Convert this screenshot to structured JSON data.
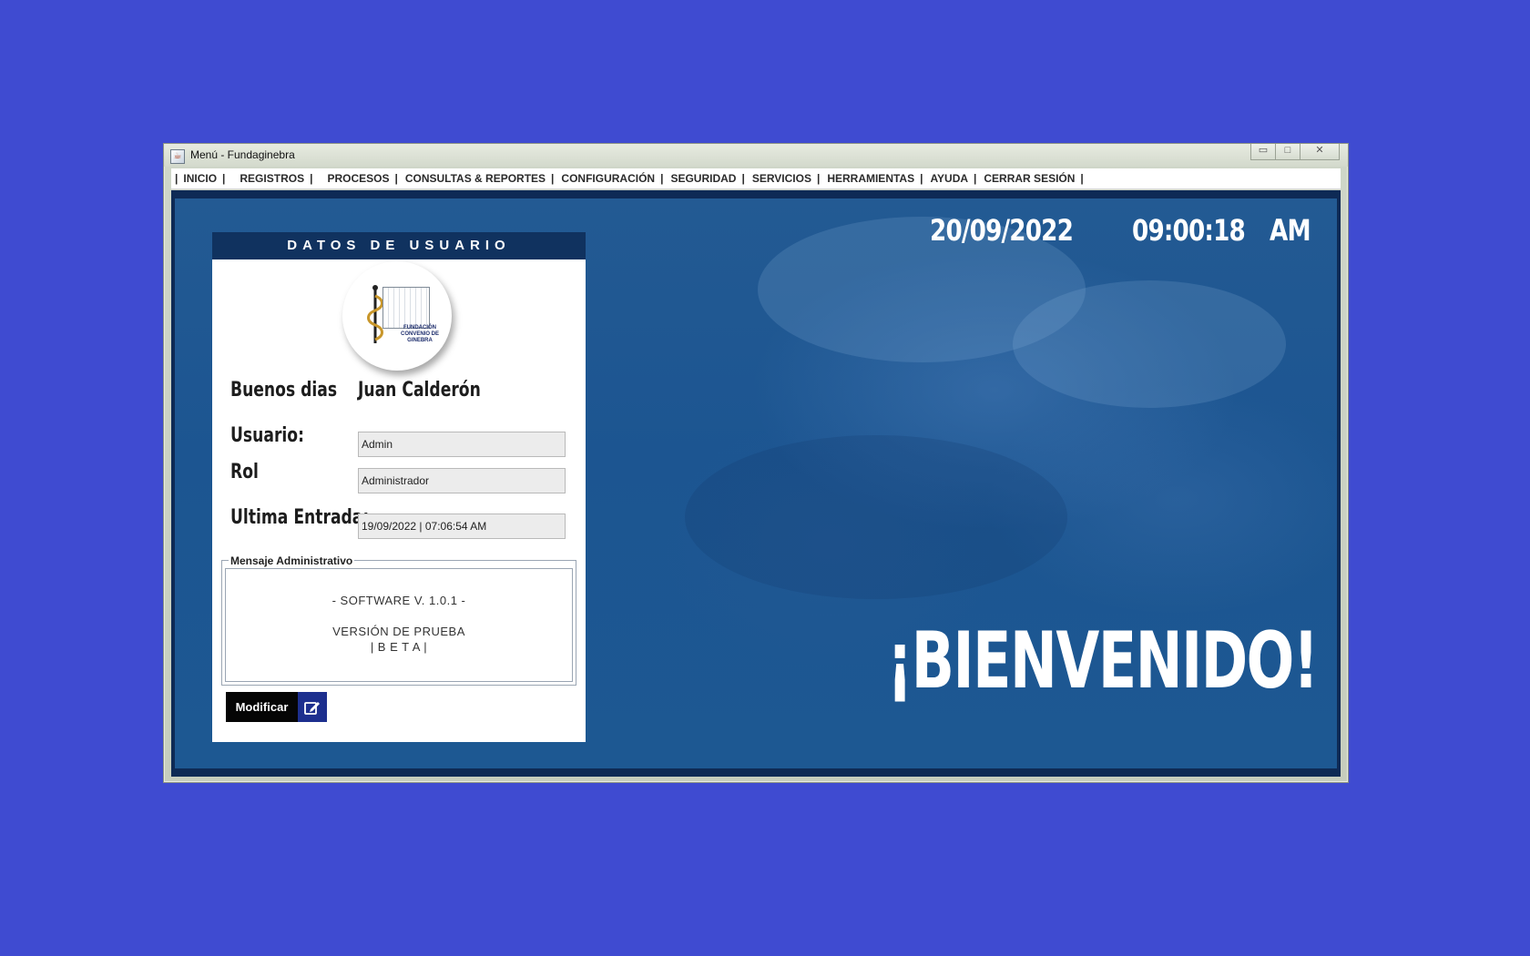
{
  "window": {
    "title": "Menú - Fundaginebra",
    "controls": [
      "minimize",
      "maximize",
      "close"
    ]
  },
  "menu": {
    "items": [
      "INICIO",
      "REGISTROS",
      "PROCESOS",
      "CONSULTAS & REPORTES",
      "CONFIGURACIÓN",
      "SEGURIDAD",
      "SERVICIOS",
      "HERRAMIENTAS",
      "AYUDA",
      "CERRAR SESIÓN"
    ],
    "separator": "|"
  },
  "clock": {
    "date": "20/09/2022",
    "time": "09:00:18",
    "ampm": "AM"
  },
  "welcome": "¡BIENVENIDO!",
  "user_panel": {
    "header": "DATOS DE USUARIO",
    "logo_text_line1": "FUNDACIÓN",
    "logo_text_line2": "CONVENIO DE GINEBRA",
    "greeting_label": "Buenos dias",
    "greeting_name": "Juan Calderón",
    "usuario_label": "Usuario:",
    "usuario_value": "Admin",
    "rol_label": "Rol",
    "rol_value": "Administrador",
    "ultima_label": "Ultima Entrada:",
    "ultima_value": "19/09/2022 | 07:06:54 AM",
    "message_legend": "Mensaje Administrativo",
    "message_line1": "- SOFTWARE V. 1.0.1 -",
    "message_line2": "VERSIÓN DE PRUEBA",
    "message_line3": "| B E T A |",
    "modify_label": "Modificar"
  },
  "colors": {
    "desktop": "#3f4bd1",
    "panel_header": "#10325f",
    "content_blue": "#1d5892",
    "button_black": "#050505",
    "button_icon": "#1d2f8e"
  },
  "icons": [
    "app-icon",
    "edit-icon",
    "minimize-icon",
    "maximize-icon",
    "close-icon"
  ]
}
